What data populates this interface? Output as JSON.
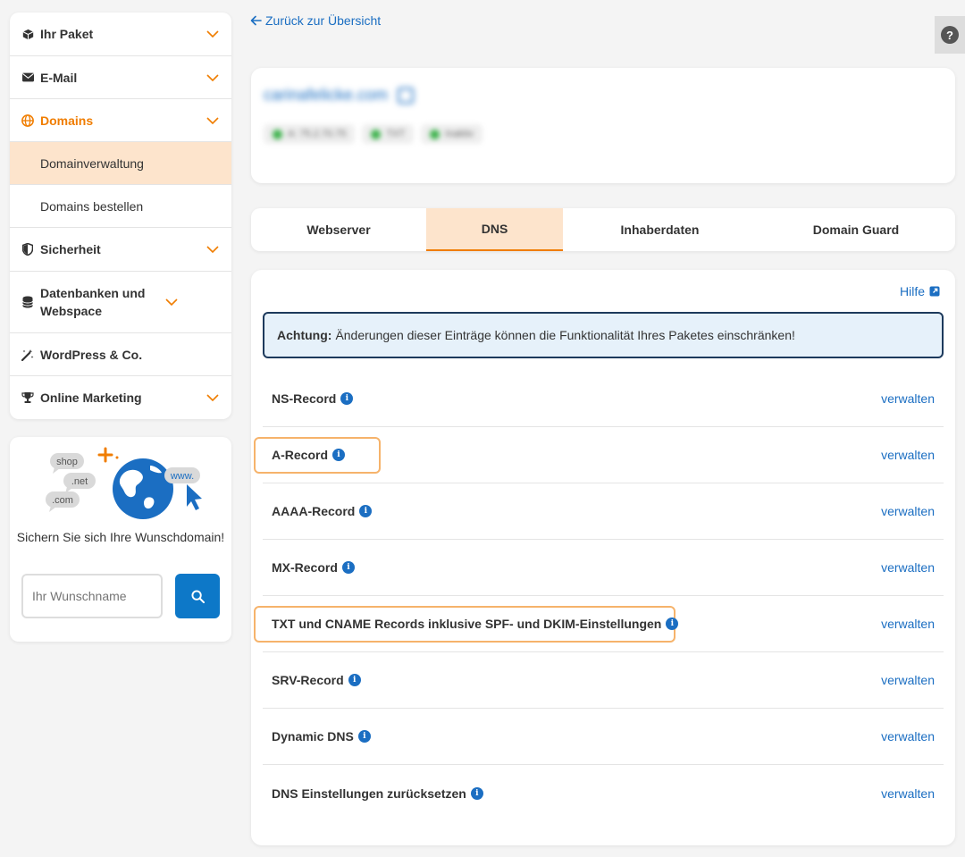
{
  "sidebar": {
    "items": [
      {
        "label": "Ihr Paket",
        "icon": "box-icon"
      },
      {
        "label": "E-Mail",
        "icon": "envelope-icon"
      },
      {
        "label": "Domains",
        "icon": "globe-icon"
      },
      {
        "label": "Sicherheit",
        "icon": "shield-icon"
      },
      {
        "label": "Datenbanken und Webspace",
        "icon": "database-icon"
      },
      {
        "label": "WordPress & Co.",
        "icon": "magic-wand-icon"
      },
      {
        "label": "Online Marketing",
        "icon": "trophy-icon"
      }
    ],
    "sub_items": [
      {
        "label": "Domainverwaltung"
      },
      {
        "label": "Domains bestellen"
      }
    ]
  },
  "promo": {
    "illus_tags": [
      "shop",
      ".net",
      ".com",
      "www."
    ],
    "text": "Sichern Sie sich Ihre Wunschdomain!",
    "input_placeholder": "Ihr Wunschname"
  },
  "header": {
    "back_link": "Zurück zur Übersicht",
    "help_label": "?"
  },
  "domain_card": {
    "domain_name": "carinafelicke.com",
    "badges": [
      "A: 75.2.70.75",
      "TXT",
      "Inaktiv"
    ]
  },
  "tabs": [
    {
      "label": "Webserver"
    },
    {
      "label": "DNS"
    },
    {
      "label": "Inhaberdaten"
    },
    {
      "label": "Domain Guard"
    }
  ],
  "dns": {
    "help_link": "Hilfe",
    "alert_bold": "Achtung:",
    "alert_text": "Änderungen dieser Einträge können die Funktionalität Ihres Paketes einschränken!",
    "info_glyph": "i",
    "records": [
      {
        "name": "NS-Record",
        "action": "verwalten"
      },
      {
        "name": "A-Record",
        "action": "verwalten"
      },
      {
        "name": "AAAA-Record",
        "action": "verwalten"
      },
      {
        "name": "MX-Record",
        "action": "verwalten"
      },
      {
        "name": "TXT und CNAME Records inklusive SPF- und DKIM-Einstellungen",
        "action": "verwalten"
      },
      {
        "name": "SRV-Record",
        "action": "verwalten"
      },
      {
        "name": "Dynamic DNS",
        "action": "verwalten"
      },
      {
        "name": "DNS Einstellungen zurücksetzen",
        "action": "verwalten"
      }
    ]
  },
  "colors": {
    "accent": "#f07d00",
    "link": "#1b6ec2",
    "highlight_border": "#f6b36b",
    "selected_bg": "#fde4cc"
  }
}
